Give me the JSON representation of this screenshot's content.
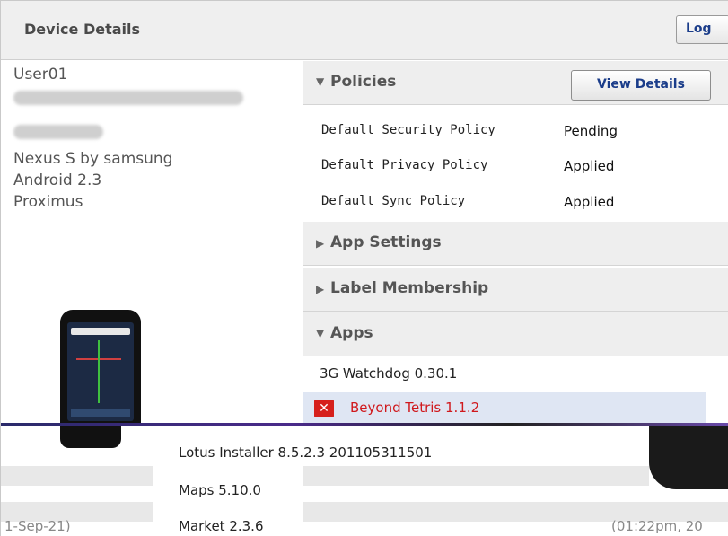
{
  "header": {
    "title": "Device Details",
    "log_label": "Log"
  },
  "device": {
    "user": "User01",
    "model": "Nexus S by samsung",
    "os": "Android 2.3",
    "carrier": "Proximus"
  },
  "policies": {
    "title": "Policies",
    "view_details_label": "View Details",
    "rows": [
      {
        "name": "Default Security Policy",
        "status": "Pending"
      },
      {
        "name": "Default Privacy Policy",
        "status": "Applied"
      },
      {
        "name": "Default Sync Policy",
        "status": "Applied"
      }
    ]
  },
  "sections": {
    "app_settings": "App Settings",
    "label_membership": "Label Membership",
    "apps": "Apps"
  },
  "apps": [
    {
      "name": "3G Watchdog 0.30.1",
      "error": false
    },
    {
      "name": "Beyond Tetris 1.1.2",
      "error": true
    },
    {
      "name": "Lotus Installer 8.5.2.3 201105311501",
      "error": false
    },
    {
      "name": "Maps 5.10.0",
      "error": false
    },
    {
      "name": "Market 2.3.6",
      "error": false
    }
  ],
  "footer": {
    "left_fragment": "1-Sep-21)",
    "right_fragment": "(01:22pm, 20"
  },
  "icons": {
    "expanded": "triangle-down-icon",
    "collapsed": "triangle-right-icon",
    "error": "error-x-icon"
  },
  "colors": {
    "link_blue": "#1b3d8a",
    "error_red": "#d0181c",
    "error_row_bg": "#dfe6f3"
  }
}
